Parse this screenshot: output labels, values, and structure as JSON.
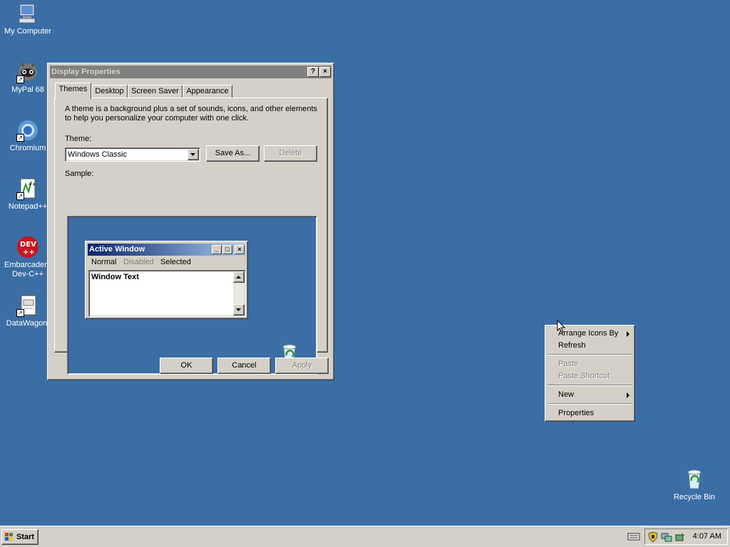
{
  "desktop": {
    "icons": [
      {
        "label": "My Computer",
        "icon": "computer-icon"
      },
      {
        "label": "MyPal 68",
        "icon": "raccoon-browser-icon"
      },
      {
        "label": "Chromium",
        "icon": "chromium-icon"
      },
      {
        "label": "Notepad++",
        "icon": "notepad-plus-icon"
      },
      {
        "label": "Embarcadero Dev-C++",
        "icon": "devcpp-icon"
      },
      {
        "label": "DataWagon.",
        "icon": "document-icon"
      },
      {
        "label": "Recycle Bin",
        "icon": "recycle-bin-icon"
      }
    ],
    "background_color": "#3a6ea5"
  },
  "dialog": {
    "title": "Display Properties",
    "help_button": "?",
    "close_button": "×",
    "tabs": [
      "Themes",
      "Desktop",
      "Screen Saver",
      "Appearance"
    ],
    "active_tab": "Themes",
    "description_line1": "A theme is a background plus a set of sounds, icons, and other elements",
    "description_line2": "to help you personalize your computer with one click.",
    "theme_label": "Theme:",
    "theme_value": "Windows Classic",
    "save_as_label": "Save As...",
    "delete_label": "Delete",
    "sample_label": "Sample:",
    "sample": {
      "window_title": "Active Window",
      "menu_normal": "Normal",
      "menu_disabled": "Disabled",
      "menu_selected": "Selected",
      "window_text": "Window Text"
    },
    "ok_label": "OK",
    "cancel_label": "Cancel",
    "apply_label": "Apply"
  },
  "context_menu": {
    "arrange_icons_by": "Arrange Icons By",
    "refresh": "Refresh",
    "paste": "Paste",
    "paste_shortcut": "Paste Shortcut",
    "new": "New",
    "properties": "Properties"
  },
  "taskbar": {
    "start_label": "Start",
    "clock": "4:07 AM",
    "tray_icons": [
      "keyboard-icon",
      "security-shield-icon",
      "network-icon",
      "safely-remove-icon"
    ]
  },
  "colors": {
    "title_active_start": "#0a246a",
    "title_active_end": "#a6caf0",
    "title_inactive": "#808080",
    "face": "#d4d0c8"
  }
}
